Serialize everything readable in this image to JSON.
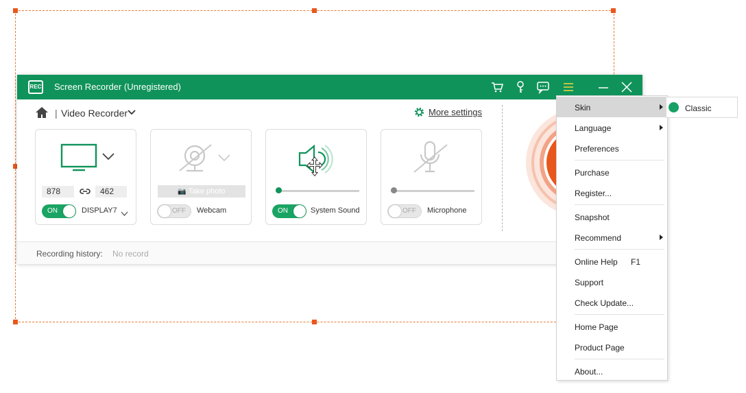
{
  "app": {
    "title": "Screen Recorder (Unregistered)",
    "logo_text": "REC",
    "accent_color": "#10935a",
    "record_color": "#e8581d"
  },
  "titlebar_icons": [
    "cart-icon",
    "key-icon",
    "feedback-icon",
    "menu-icon",
    "minimize-icon",
    "close-icon"
  ],
  "nav": {
    "separator": "|",
    "mode": "Video Recorder"
  },
  "more_settings": "More settings",
  "display": {
    "width": "878",
    "height": "462",
    "toggle": "ON",
    "label": "DISPLAY7"
  },
  "webcam": {
    "take_photo": "Take photo",
    "toggle": "OFF",
    "label": "Webcam"
  },
  "system_sound": {
    "toggle": "ON",
    "label": "System Sound",
    "volume": 0.0
  },
  "microphone": {
    "toggle": "OFF",
    "label": "Microphone",
    "volume": 0.0
  },
  "footer": {
    "history_label": "Recording history:",
    "history_value": "No record"
  },
  "menu": {
    "items": [
      {
        "label": "Skin",
        "submenu": true,
        "highlighted": true
      },
      {
        "label": "Language",
        "submenu": true
      },
      {
        "label": "Preferences"
      },
      {
        "label": "Purchase"
      },
      {
        "label": "Register..."
      },
      {
        "label": "Snapshot"
      },
      {
        "label": "Recommend",
        "submenu": true
      },
      {
        "label": "Online Help",
        "shortcut": "F1"
      },
      {
        "label": "Support"
      },
      {
        "label": "Check Update..."
      },
      {
        "label": "Home Page"
      },
      {
        "label": "Product Page"
      },
      {
        "label": "About..."
      }
    ]
  },
  "skin_submenu": {
    "items": [
      {
        "label": "Classic",
        "color": "#17a165"
      }
    ]
  }
}
